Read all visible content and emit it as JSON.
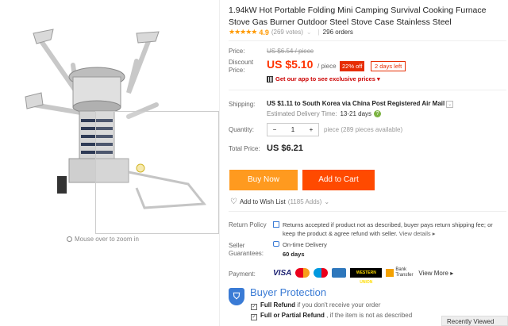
{
  "product": {
    "title": "1.94kW Hot Portable Folding Mini Camping Survival Cooking Furnace Stove Gas Burner Outdoor Steel Stove Case Stainless Steel",
    "stars": "★★★★★",
    "rating": "4.9",
    "votes": "(269 votes)",
    "orders": "296 orders"
  },
  "gallery": {
    "zoom_hint": "Mouse over to zoom in"
  },
  "price": {
    "label": "Price:",
    "original": "US $6.54 / piece",
    "discount_label": "Discount Price:",
    "discount": "US $5.10",
    "unit": "/ piece",
    "off": "22% off",
    "days_left": "2 days left",
    "app_promo": "Get our app to see exclusive prices ▾"
  },
  "shipping": {
    "label": "Shipping:",
    "text": "US $1.11 to South Korea via China Post Registered Air Mail",
    "estimate_label": "Estimated Delivery Time:",
    "estimate_days": "13-21  days"
  },
  "quantity": {
    "label": "Quantity:",
    "minus": "−",
    "value": "1",
    "plus": "+",
    "available": "piece (289 pieces available)"
  },
  "total": {
    "label": "Total Price:",
    "value": "US $6.21"
  },
  "buttons": {
    "buy_now": "Buy Now",
    "add_to_cart": "Add to Cart"
  },
  "wishlist": {
    "label": "Add to Wish List",
    "count": "(1185 Adds)",
    "chevron": "⌄"
  },
  "return_policy": {
    "label": "Return Policy",
    "text": "Returns accepted if product not as described, buyer pays return shipping fee; or keep the product & agree refund with seller.",
    "more": "View details ▸"
  },
  "seller": {
    "label": "Seller Guarantees:",
    "line1": "On-time Delivery",
    "line2": "60 days"
  },
  "payment": {
    "label": "Payment:",
    "visa": "VISA",
    "western_union": "WESTERN UNION",
    "bank": "Bank Transfer",
    "view_more": "View More ▸"
  },
  "protection": {
    "title": "Buyer Protection",
    "line1_bold": "Full Refund",
    "line1": " if you don't receive your order",
    "line2_bold": "Full or Partial Refund",
    "line2": " , if the item is not as described"
  },
  "recently_viewed": "Recently Viewed",
  "colors": {
    "price": "#ff3300",
    "buy_now": "#ff9a1f",
    "add_to_cart": "#ff4a00",
    "protection": "#3a7bd5"
  }
}
